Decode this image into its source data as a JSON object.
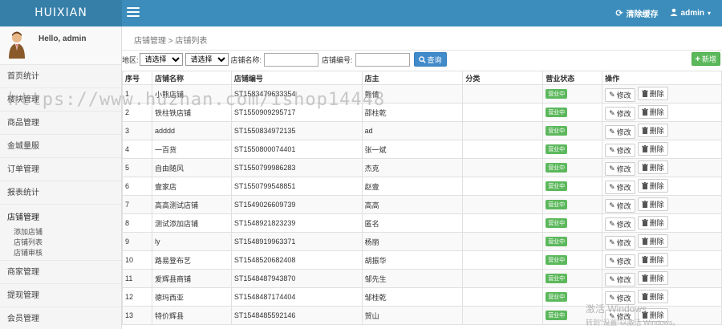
{
  "app": {
    "logo": "HUIXIAN"
  },
  "header": {
    "clear_cache": "清除缓存",
    "user": "admin",
    "user_caret": "▾"
  },
  "sidebar": {
    "greeting": "Hello, admin",
    "items_top": [
      "首页统计",
      "楼块管理",
      "商品管理",
      "金城量服",
      "订单管理",
      "报表统计"
    ],
    "open_section": {
      "label": "店铺管理",
      "children": [
        "添加店铺",
        "店铺列表",
        "店铺审核"
      ]
    },
    "items_bottom": [
      "商家管理",
      "提现管理",
      "会员管理"
    ]
  },
  "breadcrumb": "店铺管理 > 店铺列表",
  "filters": {
    "region_label": "地区:",
    "select1": "请选择",
    "select2": "请选择",
    "shop_name_label": "店铺名称:",
    "shop_no_label": "店铺编号:",
    "search_label": "查询",
    "add_label": "新增"
  },
  "table": {
    "headers": [
      "序号",
      "店铺名称",
      "店铺编号",
      "店主",
      "分类",
      "营业状态",
      "操作"
    ],
    "edit_label": "修改",
    "delete_label": "删除",
    "rows": [
      {
        "no": "1",
        "name": "小熊店铺",
        "code": "ST1583479633354",
        "owner": "熊倩",
        "category": "",
        "status": "营业中"
      },
      {
        "no": "2",
        "name": "铁柱铁店铺",
        "code": "ST1550909295717",
        "owner": "邵柱乾",
        "category": "",
        "status": "营业中"
      },
      {
        "no": "3",
        "name": "adddd",
        "code": "ST1550834972135",
        "owner": "ad",
        "category": "",
        "status": "营业中"
      },
      {
        "no": "4",
        "name": "一百货",
        "code": "ST1550800074401",
        "owner": "张一斌",
        "category": "",
        "status": "营业中"
      },
      {
        "no": "5",
        "name": "自由随风",
        "code": "ST1550799986283",
        "owner": "杰克",
        "category": "",
        "status": "营业中"
      },
      {
        "no": "6",
        "name": "壹家店",
        "code": "ST1550799548851",
        "owner": "赵壹",
        "category": "",
        "status": "营业中"
      },
      {
        "no": "7",
        "name": "高高测试店铺",
        "code": "ST1549026609739",
        "owner": "高高",
        "category": "",
        "status": "营业中"
      },
      {
        "no": "8",
        "name": "测试添加店铺",
        "code": "ST1548921823239",
        "owner": "匿名",
        "category": "",
        "status": "营业中"
      },
      {
        "no": "9",
        "name": "ly",
        "code": "ST1548919963371",
        "owner": "杨丽",
        "category": "",
        "status": "营业中"
      },
      {
        "no": "10",
        "name": "路易登布艺",
        "code": "ST1548520682408",
        "owner": "胡振华",
        "category": "",
        "status": "营业中"
      },
      {
        "no": "11",
        "name": "爱辉县商铺",
        "code": "ST1548487943870",
        "owner": "邹先生",
        "category": "",
        "status": "营业中"
      },
      {
        "no": "12",
        "name": "德玛西亚",
        "code": "ST1548487174404",
        "owner": "邹桂乾",
        "category": "",
        "status": "营业中"
      },
      {
        "no": "13",
        "name": "特价辉县",
        "code": "ST1548485592146",
        "owner": "贺山",
        "category": "",
        "status": "营业中"
      }
    ]
  },
  "overlay": {
    "watermark": "https://www.huzhan.com/ishop14448",
    "activate_line1": "激活 Windows",
    "activate_line2": "转到\"设置\"以激活 Windows。"
  },
  "colors": {
    "topbar": "#3c8dbc",
    "logo_bg": "#367fa9",
    "badge": "#5cb85c",
    "search": "#428bca"
  },
  "icons": {
    "menu": "hamburger-icon",
    "refresh": "refresh-icon",
    "user": "user-icon",
    "search": "search-icon",
    "add": "plus-icon",
    "edit": "pencil-icon",
    "delete": "trash-icon"
  }
}
